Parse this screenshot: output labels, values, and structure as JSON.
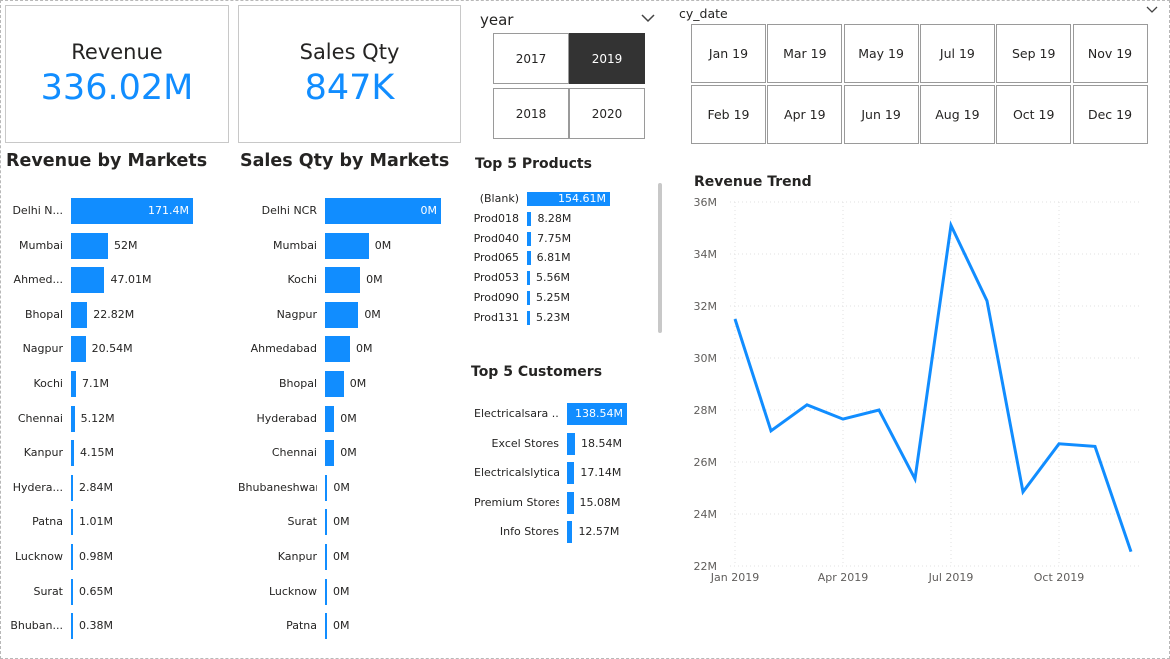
{
  "kpis": {
    "revenue": {
      "label": "Revenue",
      "value": "336.02M"
    },
    "sales_qty": {
      "label": "Sales Qty",
      "value": "847K"
    }
  },
  "year_slicer": {
    "title": "year",
    "options": [
      "2017",
      "2019",
      "2018",
      "2020"
    ],
    "selected": "2019"
  },
  "date_slicer": {
    "title": "cy_date",
    "options": [
      "Jan 19",
      "Mar 19",
      "May 19",
      "Jul 19",
      "Sep 19",
      "Nov 19",
      "Feb 19",
      "Apr 19",
      "Jun 19",
      "Aug 19",
      "Oct 19",
      "Dec 19"
    ]
  },
  "revenue_by_markets": {
    "title": "Revenue by Markets",
    "labels": [
      "Delhi N...",
      "Mumbai",
      "Ahmed...",
      "Bhopal",
      "Nagpur",
      "Kochi",
      "Chennai",
      "Kanpur",
      "Hydera...",
      "Patna",
      "Lucknow",
      "Surat",
      "Bhuban..."
    ],
    "value_labels": [
      "171.4M",
      "52M",
      "47.01M",
      "22.82M",
      "20.54M",
      "7.1M",
      "5.12M",
      "4.15M",
      "2.84M",
      "1.01M",
      "0.98M",
      "0.65M",
      "0.38M"
    ],
    "values": [
      171.4,
      52,
      47.01,
      22.82,
      20.54,
      7.1,
      5.12,
      4.15,
      2.84,
      1.01,
      0.98,
      0.65,
      0.38
    ]
  },
  "sales_qty_by_markets": {
    "title": "Sales Qty by Markets",
    "labels": [
      "Delhi NCR",
      "Mumbai",
      "Kochi",
      "Nagpur",
      "Ahmedabad",
      "Bhopal",
      "Hyderabad",
      "Chennai",
      "Bhubaneshwar",
      "Surat",
      "Kanpur",
      "Lucknow",
      "Patna"
    ],
    "value_labels": [
      "0M",
      "0M",
      "0M",
      "0M",
      "0M",
      "0M",
      "0M",
      "0M",
      "0M",
      "0M",
      "0M",
      "0M",
      "0M"
    ],
    "values": [
      0.39,
      0.147,
      0.118,
      0.112,
      0.084,
      0.063,
      0.031,
      0.031,
      0.008,
      0.007,
      0.004,
      0.004,
      0.003
    ]
  },
  "top5_products": {
    "title": "Top 5 Products",
    "labels": [
      "(Blank)",
      "Prod018",
      "Prod040",
      "Prod065",
      "Prod053",
      "Prod090",
      "Prod131"
    ],
    "value_labels": [
      "154.61M",
      "8.28M",
      "7.75M",
      "6.81M",
      "5.56M",
      "5.25M",
      "5.23M"
    ],
    "values": [
      154.61,
      8.28,
      7.75,
      6.81,
      5.56,
      5.25,
      5.23
    ]
  },
  "top5_customers": {
    "title": "Top 5 Customers",
    "labels": [
      "Electricalsara ...",
      "Excel Stores",
      "Electricalslytical",
      "Premium Stores",
      "Info Stores"
    ],
    "value_labels": [
      "138.54M",
      "18.54M",
      "17.14M",
      "15.08M",
      "12.57M"
    ],
    "values": [
      138.54,
      18.54,
      17.14,
      15.08,
      12.57
    ]
  },
  "chart_data": {
    "type": "line",
    "title": "Revenue Trend",
    "x": [
      "Jan 2019",
      "Feb 2019",
      "Mar 2019",
      "Apr 2019",
      "May 2019",
      "Jun 2019",
      "Jul 2019",
      "Aug 2019",
      "Sep 2019",
      "Oct 2019",
      "Nov 2019",
      "Dec 2019"
    ],
    "series": [
      {
        "values": [
          31.5,
          27.2,
          28.2,
          27.65,
          28.0,
          25.35,
          35.1,
          32.2,
          24.85,
          26.7,
          26.6,
          22.55
        ]
      }
    ],
    "xticks": [
      "Jan 2019",
      "Apr 2019",
      "Jul 2019",
      "Oct 2019"
    ],
    "yticks": [
      "22M",
      "24M",
      "26M",
      "28M",
      "30M",
      "32M",
      "34M",
      "36M"
    ],
    "ylim": [
      22,
      36
    ],
    "grid": true,
    "color": "#118DFF"
  }
}
